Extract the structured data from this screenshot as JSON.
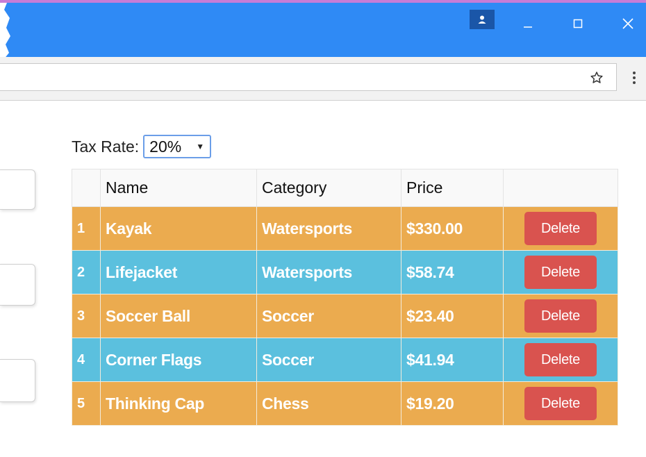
{
  "window": {
    "profile_icon": "person-icon",
    "minimize_icon": "minimize-icon",
    "maximize_icon": "maximize-icon",
    "close_icon": "close-icon",
    "titlebar_color": "#2f8af5"
  },
  "toolbar": {
    "bookmark_icon": "star-icon",
    "menu_icon": "more-vert-icon"
  },
  "tax": {
    "label": "Tax Rate:",
    "selected": "20%"
  },
  "table": {
    "columns": [
      "",
      "Name",
      "Category",
      "Price",
      ""
    ],
    "rows": [
      {
        "index": "1",
        "name": "Kayak",
        "category": "Watersports",
        "price": "$330.00",
        "style": "warning",
        "action": "Delete"
      },
      {
        "index": "2",
        "name": "Lifejacket",
        "category": "Watersports",
        "price": "$58.74",
        "style": "info",
        "action": "Delete"
      },
      {
        "index": "3",
        "name": "Soccer Ball",
        "category": "Soccer",
        "price": "$23.40",
        "style": "warning",
        "action": "Delete"
      },
      {
        "index": "4",
        "name": "Corner Flags",
        "category": "Soccer",
        "price": "$41.94",
        "style": "info",
        "action": "Delete"
      },
      {
        "index": "5",
        "name": "Thinking Cap",
        "category": "Chess",
        "price": "$19.20",
        "style": "warning",
        "action": "Delete"
      }
    ]
  },
  "colors": {
    "warning": "#ebab4f",
    "info": "#5bc0de",
    "danger": "#d9534f"
  }
}
